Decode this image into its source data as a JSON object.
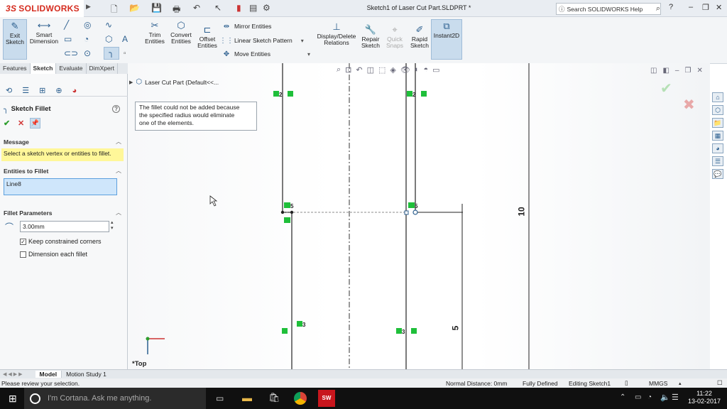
{
  "titlebar": {
    "logo_ds": "3S",
    "logo_text": "SOLIDWORKS",
    "doc_title": "Sketch1 of Laser Cut Part.SLDPRT *",
    "search_placeholder": "Search SOLIDWORKS Help",
    "help": "?"
  },
  "commands": {
    "exit_sketch": [
      "Exit",
      "Sketch"
    ],
    "smart_dimension": [
      "Smart",
      "Dimension"
    ],
    "trim_entities": [
      "Trim",
      "Entities"
    ],
    "convert_entities": [
      "Convert",
      "Entities"
    ],
    "offset_entities": [
      "Offset",
      "Entities"
    ],
    "mirror_entities": "Mirror Entities",
    "linear_sketch_pattern": "Linear Sketch Pattern",
    "move_entities": "Move Entities",
    "display_delete_relations": [
      "Display/Delete",
      "Relations"
    ],
    "repair_sketch": [
      "Repair",
      "Sketch"
    ],
    "quick_snaps": [
      "Quick",
      "Snaps"
    ],
    "rapid_sketch": [
      "Rapid",
      "Sketch"
    ],
    "instant2d": "Instant2D"
  },
  "tabs": [
    "Features",
    "Sketch",
    "Evaluate",
    "DimXpert"
  ],
  "active_tab": "Sketch",
  "property_manager": {
    "title": "Sketch Fillet",
    "help": "?",
    "message_header": "Message",
    "message_text": "Select a sketch vertex or entities to fillet.",
    "message_bg": "#fff799",
    "entities_header": "Entities to Fillet",
    "entities_item": "Line8",
    "params_header": "Fillet Parameters",
    "radius_value": "3.00mm",
    "keep_corners_label": "Keep constrained corners",
    "keep_corners_checked": true,
    "dimension_each_label": "Dimension each fillet",
    "dimension_each_checked": false
  },
  "graphics": {
    "tree_root": "Laser Cut Part  (Default<<...",
    "tooltip": [
      "The fillet could not be added because",
      "the specified radius would eliminate",
      "one of the elements."
    ],
    "dim_10": "10",
    "dim_5": "5",
    "view_label": "*Top",
    "relation_labels": [
      "2",
      "2",
      "5",
      "5",
      "3",
      "3"
    ]
  },
  "bottom_tabs": [
    "Model",
    "Motion Study 1"
  ],
  "status": {
    "left": "Please review your selection.",
    "normal_distance": "Normal Distance: 0mm",
    "defined": "Fully Defined",
    "editing": "Editing Sketch1",
    "units": "MMGS"
  },
  "taskbar": {
    "cortana": "I'm Cortana. Ask me anything.",
    "time": "11:22",
    "date": "13-02-2017"
  },
  "colors": {
    "accent": "#2c5f8f",
    "relation_green": "#1fbf3a",
    "confirm_green": "#2e9e2e",
    "cancel_red": "#d23a3a"
  }
}
